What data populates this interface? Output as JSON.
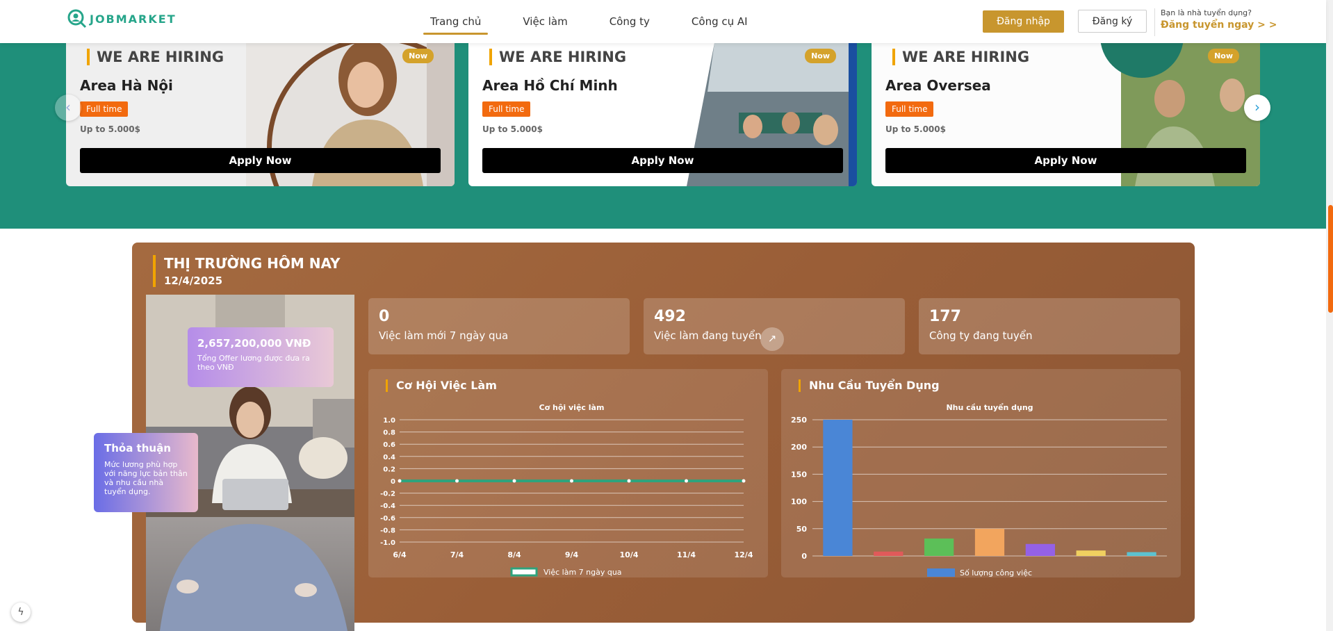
{
  "nav": {
    "logo_text": "JOBMARKET",
    "links": [
      "Trang chủ",
      "Việc làm",
      "Công ty",
      "Công cụ AI"
    ],
    "login": "Đăng nhập",
    "register": "Đăng ký",
    "employer_question": "Bạn là nhà tuyển dụng?",
    "employer_link": "Đăng tuyển ngay > >"
  },
  "hero": {
    "cards": [
      {
        "hiring": "WE ARE HIRING",
        "area": "Area Hà Nội",
        "badge": "Full time",
        "salary": "Up to 5.000$",
        "apply": "Apply Now",
        "now": "Now"
      },
      {
        "hiring": "WE ARE HIRING",
        "area": "Area Hồ Chí Minh",
        "badge": "Full time",
        "salary": "Up to 5.000$",
        "apply": "Apply Now",
        "now": "Now"
      },
      {
        "hiring": "WE ARE HIRING",
        "area": "Area Oversea",
        "badge": "Full time",
        "salary": "Up to 5.000$",
        "apply": "Apply Now",
        "now": "Now"
      }
    ]
  },
  "market": {
    "title": "THỊ TRƯỜNG HÔM NAY",
    "date": "12/4/2025",
    "offer_amount": "2,657,200,000 VNĐ",
    "offer_desc": "Tổng Offer lương được đưa ra theo VNĐ",
    "deal_title": "Thỏa thuận",
    "deal_desc": "Mức lương phù hợp với năng lực bản thân và nhu cầu nhà tuyển dụng.",
    "stats": [
      {
        "num": "0",
        "label": "Việc làm mới 7 ngày qua"
      },
      {
        "num": "492",
        "label": "Việc làm đang tuyển"
      },
      {
        "num": "177",
        "label": "Công ty đang tuyển"
      }
    ],
    "chart1_header": "Cơ Hội Việc Làm",
    "chart2_header": "Nhu Cầu Tuyển Dụng"
  },
  "chart_data": [
    {
      "type": "line",
      "title": "Cơ hội việc làm",
      "categories": [
        "6/4",
        "7/4",
        "8/4",
        "9/4",
        "10/4",
        "11/4",
        "12/4"
      ],
      "series": [
        {
          "name": "Việc làm 7  ngày qua",
          "values": [
            0,
            0,
            0,
            0,
            0,
            0,
            0
          ]
        }
      ],
      "ylim": [
        -1.0,
        1.0
      ],
      "yticks": [
        "1.0",
        "0.8",
        "0.6",
        "0.4",
        "0.2",
        "0",
        "-0.2",
        "-0.4",
        "-0.6",
        "-0.8",
        "-1.0"
      ],
      "line_color": "#2fa37c"
    },
    {
      "type": "bar",
      "title": "Nhu cầu tuyển dụng",
      "categories": [
        "",
        "",
        "",
        "",
        "",
        "",
        ""
      ],
      "series": [
        {
          "name": "Số lượng công việc",
          "values": [
            250,
            8,
            32,
            50,
            22,
            10,
            7
          ]
        }
      ],
      "ylim": [
        0,
        250
      ],
      "yticks": [
        "250",
        "200",
        "150",
        "100",
        "50",
        "0"
      ],
      "bar_colors": [
        "#4a86d6",
        "#e05a5a",
        "#5cbf58",
        "#f2a55e",
        "#9461e6",
        "#f0d060",
        "#5cc2d0"
      ]
    }
  ]
}
